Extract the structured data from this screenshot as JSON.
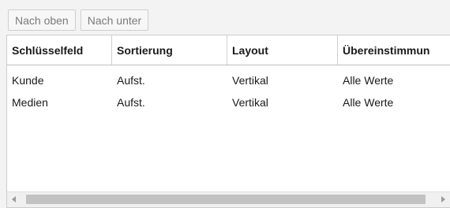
{
  "toolbar": {
    "up_label": "Nach oben",
    "down_label": "Nach unter"
  },
  "table": {
    "columns": [
      "Schlüsselfeld",
      "Sortierung",
      "Layout",
      "Übereinstimmun"
    ],
    "rows": [
      [
        "Kunde",
        "Aufst.",
        "Vertikal",
        "Alle Werte"
      ],
      [
        "Medien",
        "Aufst.",
        "Vertikal",
        "Alle Werte"
      ]
    ]
  },
  "scrollbar": {
    "left_icon": "arrow-left-icon",
    "right_icon": "arrow-right-icon"
  }
}
